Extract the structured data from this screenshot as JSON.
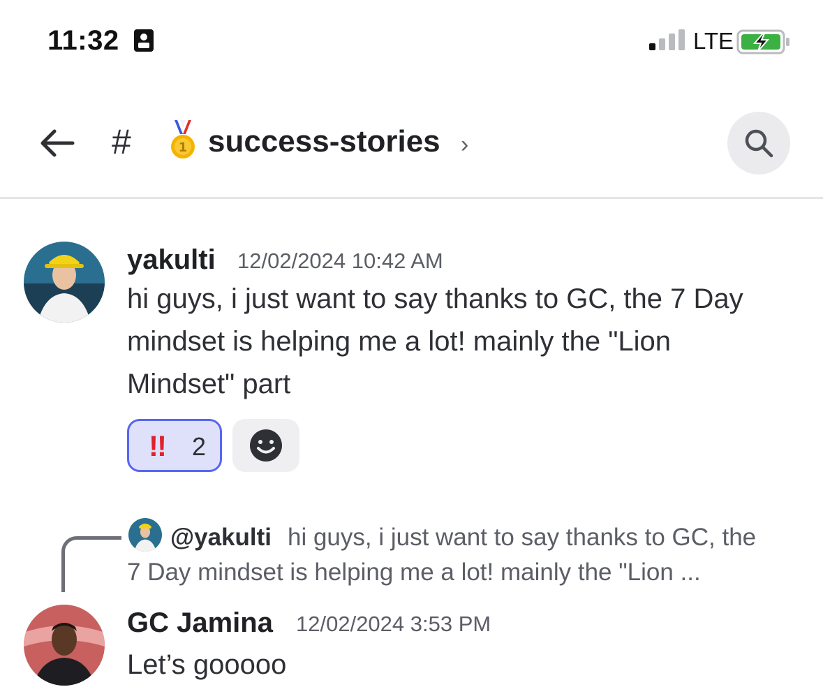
{
  "status_bar": {
    "time": "11:32",
    "network": "LTE",
    "icons": [
      "sim-icon",
      "signal-icon",
      "battery-charging-icon"
    ]
  },
  "header": {
    "hash": "#",
    "channel_emoji": "medal-icon",
    "channel_name": "success-stories",
    "chevron": "›",
    "search_icon": "search-icon",
    "back_icon": "back-arrow-icon"
  },
  "messages": [
    {
      "author": "yakulti",
      "timestamp": "12/02/2024 10:42 AM",
      "lines": [
        "hi guys, i just want to say thanks to GC, the 7 Day",
        "mindset is helping me a lot! mainly the \"Lion",
        "Mindset\" part"
      ],
      "reactions": [
        {
          "emoji": "!!",
          "count": "2",
          "selected": true
        }
      ]
    },
    {
      "author": "GC Jamina",
      "timestamp": "12/02/2024 3:53 PM",
      "reply": {
        "mention": "@yakulti",
        "snippet_line1": "hi guys, i just want to say thanks to GC, the",
        "snippet_line2": "7 Day mindset is helping me a lot! mainly the \"Lion ..."
      },
      "lines": [
        "Let’s gooooo"
      ]
    }
  ],
  "colors": {
    "accent": "#5865f2",
    "reaction_bg": "#dfe1fb",
    "reaction_emoji": "#e0212b",
    "muted_text": "#5c5e66",
    "battery_green": "#3cb043"
  }
}
